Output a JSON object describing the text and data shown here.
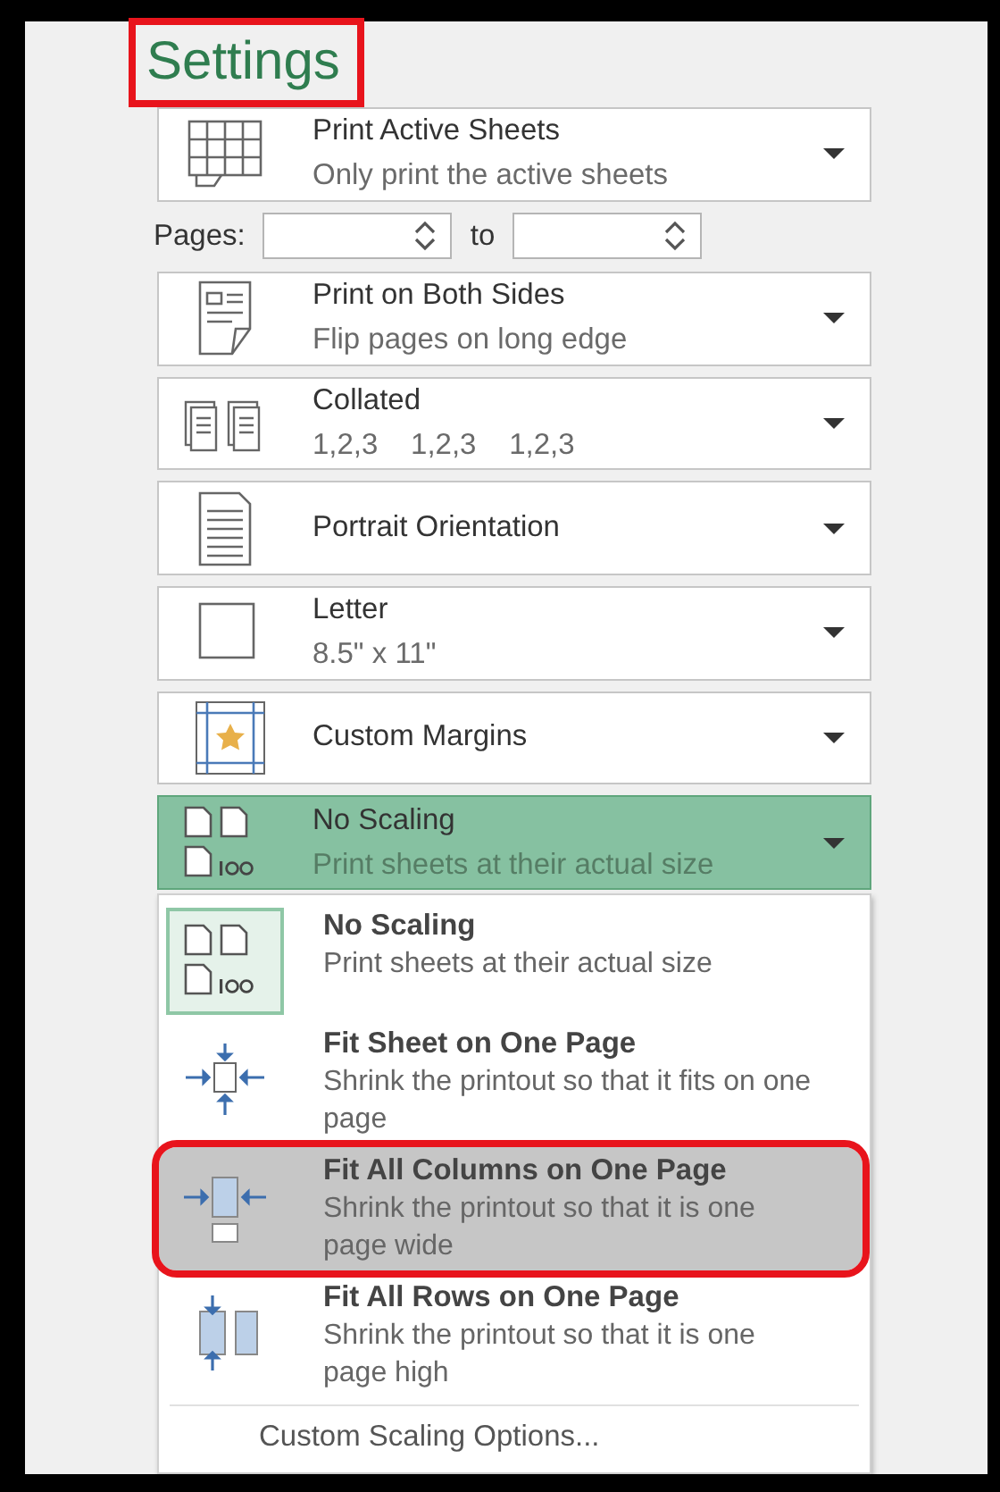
{
  "heading": {
    "text": "Settings",
    "annotated": true
  },
  "print_what": {
    "kind": "sheets",
    "title": "Print Active Sheets",
    "subtitle": "Only print the active sheets",
    "open": false
  },
  "pages": {
    "label": "Pages:",
    "separator": "to"
  },
  "dropdowns": [
    {
      "kind": "duplex",
      "title": "Print on Both Sides",
      "subtitle": "Flip pages on long edge",
      "open": false
    },
    {
      "kind": "collate",
      "title": "Collated",
      "subtitle": "1,2,3    1,2,3    1,2,3",
      "open": false
    },
    {
      "kind": "portrait",
      "title": "Portrait Orientation",
      "open": false
    },
    {
      "kind": "paper",
      "title": "Letter",
      "subtitle": "8.5\" x 11\"",
      "open": false
    },
    {
      "kind": "margins",
      "title": "Custom Margins",
      "open": false
    },
    {
      "kind": "noscale",
      "title": "No Scaling",
      "subtitle": "Print sheets at their actual size",
      "open": true
    }
  ],
  "scaling_menu": {
    "items": [
      {
        "kind": "noscale",
        "title": "No Scaling",
        "description": "Print sheets at their actual size",
        "selected": true,
        "hovered": false,
        "annotated": false
      },
      {
        "kind": "fitsheet",
        "title": "Fit Sheet on One Page",
        "description": "Shrink the printout so that it fits on one page",
        "selected": false,
        "hovered": false,
        "annotated": false
      },
      {
        "kind": "fitcols",
        "title": "Fit All Columns on One Page",
        "description": "Shrink the printout so that it is one page wide",
        "selected": false,
        "hovered": true,
        "annotated": true
      },
      {
        "kind": "fitrows",
        "title": "Fit All Rows on One Page",
        "description": "Shrink the printout so that it is one page high",
        "selected": false,
        "hovered": false,
        "annotated": false
      }
    ],
    "footer": "Custom Scaling Options..."
  }
}
